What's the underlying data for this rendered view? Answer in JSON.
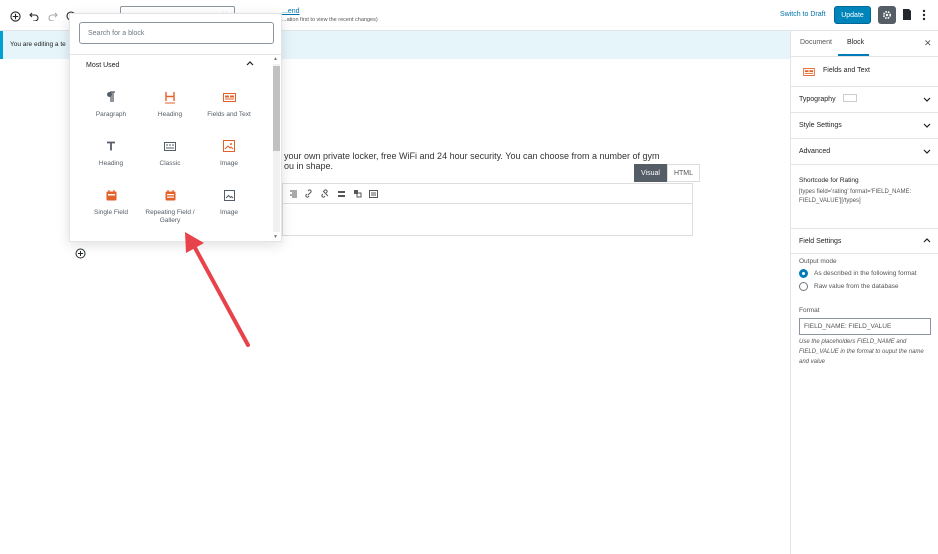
{
  "topbar": {
    "title_link": "...end",
    "title_note": "...ation first to view the recent changes)",
    "switch_to_draft": "Switch to Draft",
    "update": "Update"
  },
  "notice": {
    "text": "You are editing a te"
  },
  "content": {
    "line1": "your own private locker, free WiFi and 24 hour security. You can choose from a number of gym",
    "line2": "ou in shape.",
    "tab_visual": "Visual",
    "tab_html": "HTML"
  },
  "inserter": {
    "search_placeholder": "Search for a block",
    "panel_title": "Most Used",
    "blocks": [
      {
        "label": "Paragraph",
        "icon": "paragraph-icon"
      },
      {
        "label": "Heading",
        "icon": "heading-icon"
      },
      {
        "label": "Fields and Text",
        "icon": "fields-and-text-icon"
      },
      {
        "label": "Heading",
        "icon": "heading-t-icon"
      },
      {
        "label": "Classic",
        "icon": "classic-icon"
      },
      {
        "label": "Image",
        "icon": "image-icon"
      },
      {
        "label": "Single Field",
        "icon": "single-field-icon"
      },
      {
        "label": "Repeating Field / Gallery",
        "icon": "repeating-field-icon"
      },
      {
        "label": "Image",
        "icon": "image-icon"
      }
    ]
  },
  "sidebar": {
    "tab_document": "Document",
    "tab_block": "Block",
    "block_name": "Fields and Text",
    "typography": "Typography",
    "style_settings": "Style Settings",
    "advanced": "Advanced",
    "shortcode_title": "Shortcode for Rating",
    "shortcode_code": "[types field='rating' format='FIELD_NAME: FIELD_VALUE'][/types]",
    "field_settings": "Field Settings",
    "output_mode": "Output mode",
    "option1": "As described in the following format",
    "option2": "Raw value from the database",
    "format_label": "Format",
    "format_value": "FIELD_NAME: FIELD_VALUE",
    "format_help": "Use the placeholders FIELD_NAME and FIELD_VALUE in the format to ouput the name and value"
  },
  "colors": {
    "accent": "#0085ba",
    "block_orange": "#e2622a",
    "arrow_red": "#e8434a",
    "notice_bg": "#e5f5fa"
  }
}
